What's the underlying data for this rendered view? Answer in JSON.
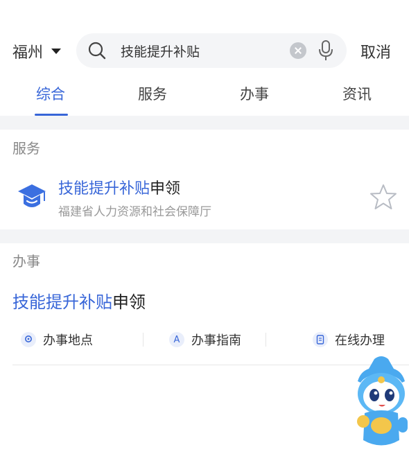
{
  "header": {
    "city": "福州",
    "search_value": "技能提升补贴",
    "cancel_label": "取消",
    "icons": [
      "chevron-down-icon",
      "search-icon",
      "clear-icon",
      "microphone-icon"
    ]
  },
  "tabs": [
    {
      "label": "综合",
      "active": true
    },
    {
      "label": "服务",
      "active": false
    },
    {
      "label": "办事",
      "active": false
    },
    {
      "label": "资讯",
      "active": false
    }
  ],
  "service_section": {
    "label": "服务",
    "item": {
      "title_highlight": "技能提升补贴",
      "title_rest": "申领",
      "provider": "福建省人力资源和社会保障厅",
      "icon": "graduation-cap-icon"
    }
  },
  "affairs_section": {
    "label": "办事",
    "item": {
      "title_highlight": "技能提升补贴",
      "title_rest": "申领",
      "actions": [
        {
          "label": "办事地点",
          "icon": "location-icon",
          "glyph": ""
        },
        {
          "label": "办事指南",
          "icon": "guide-icon",
          "glyph": "A"
        },
        {
          "label": "在线办理",
          "icon": "document-icon",
          "glyph": ""
        }
      ]
    }
  },
  "colors": {
    "accent": "#3866d8",
    "muted": "#999999",
    "divider_band": "#f3f4f6"
  }
}
